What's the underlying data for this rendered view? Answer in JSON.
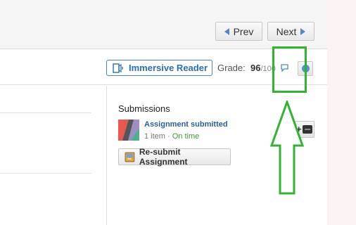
{
  "nav": {
    "prev_label": "Prev",
    "next_label": "Next"
  },
  "header": {
    "immersive_reader_label": "Immersive Reader",
    "grade_label": "Grade:",
    "grade_score": "96",
    "grade_total": "/100"
  },
  "submissions": {
    "title": "Submissions",
    "status": "Assignment submitted",
    "item_count": "1 item",
    "separator": " · ",
    "timing": "On time",
    "resubmit_label": "Re-submit Assignment"
  },
  "icons": {
    "prev": "triangle-left-icon",
    "next": "triangle-right-icon",
    "immersive_reader": "immersive-reader-icon",
    "comment": "comment-bubble-icon",
    "status": "blue-dot-icon",
    "add": "plus-tray-icon",
    "resubmit": "resubmit-icon"
  },
  "colors": {
    "accent": "#4a8ad4",
    "link": "#2a5f9e",
    "on_time": "#3b9a3b",
    "annotation": "#2fb52f"
  }
}
